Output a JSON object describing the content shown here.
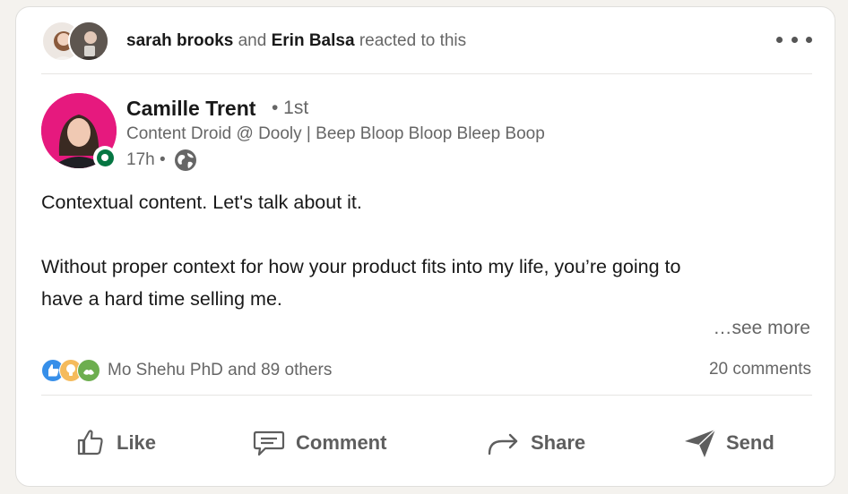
{
  "social": {
    "actor1": "sarah brooks",
    "conj": "and",
    "actor2": "Erin Balsa",
    "action": "reacted to this"
  },
  "author": {
    "name": "Camille Trent",
    "degree": "• 1st",
    "headline": "Content Droid @ Dooly | Beep Bloop Bloop Bleep Boop",
    "time": "17h •",
    "visibility_icon": "globe-icon",
    "status_color": "#057642",
    "avatar_color": "#e6197e"
  },
  "post": {
    "line1": "Contextual content. Let's talk about it.",
    "line2": "Without proper context for how your product fits into my life, you’re going to",
    "line3": "have a hard time selling me.",
    "see_more": "…see more"
  },
  "engagement": {
    "reaction_types": [
      "like-icon",
      "insightful-icon",
      "support-icon"
    ],
    "reactions_text": "Mo Shehu PhD and 89 others",
    "comments_text": "20 comments"
  },
  "actions": {
    "like": "Like",
    "comment": "Comment",
    "share": "Share",
    "send": "Send"
  }
}
